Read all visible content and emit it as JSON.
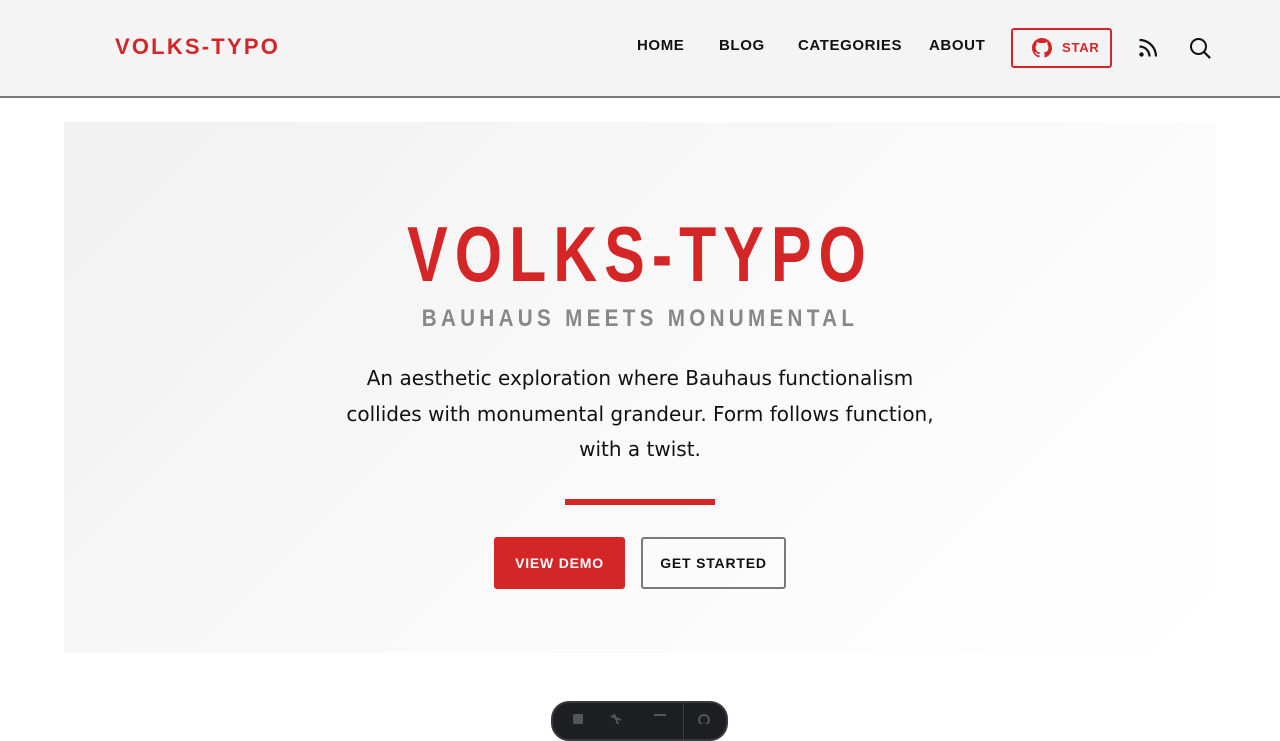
{
  "header": {
    "logo": "VOLKS-TYPO",
    "nav": [
      {
        "label": "HOME"
      },
      {
        "label": "BLOG"
      },
      {
        "label": "CATEGORIES"
      },
      {
        "label": "ABOUT"
      }
    ],
    "star_label": "STAR",
    "icons": [
      "github-icon",
      "rss-icon",
      "search-icon"
    ]
  },
  "hero": {
    "title": "VOLKS-TYPO",
    "subtitle": "BAUHAUS MEETS MONUMENTAL",
    "description": "An aesthetic exploration where Bauhaus functionalism collides with monumental grandeur. Form follows function, with a twist.",
    "primary_button": "VIEW DEMO",
    "secondary_button": "GET STARTED"
  },
  "colors": {
    "accent": "#d42626",
    "header_bg": "#f4f4f4",
    "muted_text": "#888888",
    "text": "#111111"
  }
}
